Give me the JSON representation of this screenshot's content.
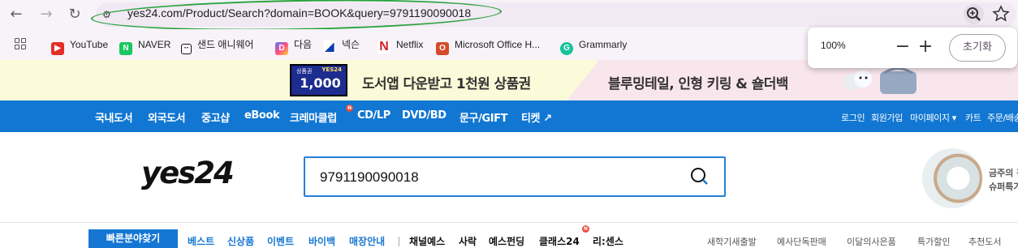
{
  "browser": {
    "url": "yes24.com/Product/Search?domain=BOOK&query=9791190090018",
    "bookmarks": [
      {
        "label": "YouTube",
        "icon": "youtube-icon"
      },
      {
        "label": "NAVER",
        "icon": "naver-icon"
      },
      {
        "label": "샌드 애니웨어",
        "icon": "sand-anywhere-icon"
      },
      {
        "label": "다음",
        "icon": "daum-icon"
      },
      {
        "label": "넥슨",
        "icon": "nexon-icon"
      },
      {
        "label": "Netflix",
        "icon": "netflix-icon"
      },
      {
        "label": "Microsoft Office H...",
        "icon": "microsoft-office-icon"
      },
      {
        "label": "Grammarly",
        "icon": "grammarly-icon"
      }
    ],
    "zoom": {
      "level": "100%",
      "reset_label": "초기화"
    }
  },
  "promo": {
    "coupon_small": "상품권",
    "coupon_logo": "YES24",
    "coupon_value": "1,000",
    "left_text": "도서앱 다운받고 1천원 상품권",
    "right_text": "블루밍테일, 인형 키링 & 숄더백"
  },
  "header": {
    "logo": "yes24",
    "categories": [
      "국내도서",
      "외국도서",
      "중고샵",
      "eBook",
      "크레마클럽",
      "CD/LP",
      "DVD/BD",
      "문구/GIFT",
      "티켓 ↗"
    ],
    "new_badge": "N",
    "user_links": [
      "로그인",
      "회원가입",
      "마이페이지 ▾",
      "카트",
      "주문/배송"
    ],
    "search": {
      "value": "9791190090018"
    },
    "ad": {
      "line1": "금주의 편",
      "line2": "슈퍼특가"
    }
  },
  "subnav": {
    "quick_button": "빠른분야찾기",
    "blue_links": [
      "베스트",
      "신상품",
      "이벤트",
      "바이백",
      "매장안내"
    ],
    "black_links": [
      "채널예스",
      "사락",
      "예스펀딩",
      "클래스24",
      "리:센스"
    ],
    "new_badge": "N",
    "gray_links": [
      "새학기새출발",
      "예사단독판매",
      "이달의사은품",
      "특가할인",
      "추천도서"
    ]
  },
  "colors": {
    "brand_blue": "#1177d2",
    "url_highlight": "#27a33c",
    "promo_yellow": "#fcfbd9",
    "promo_pink": "#f9e6ec"
  }
}
